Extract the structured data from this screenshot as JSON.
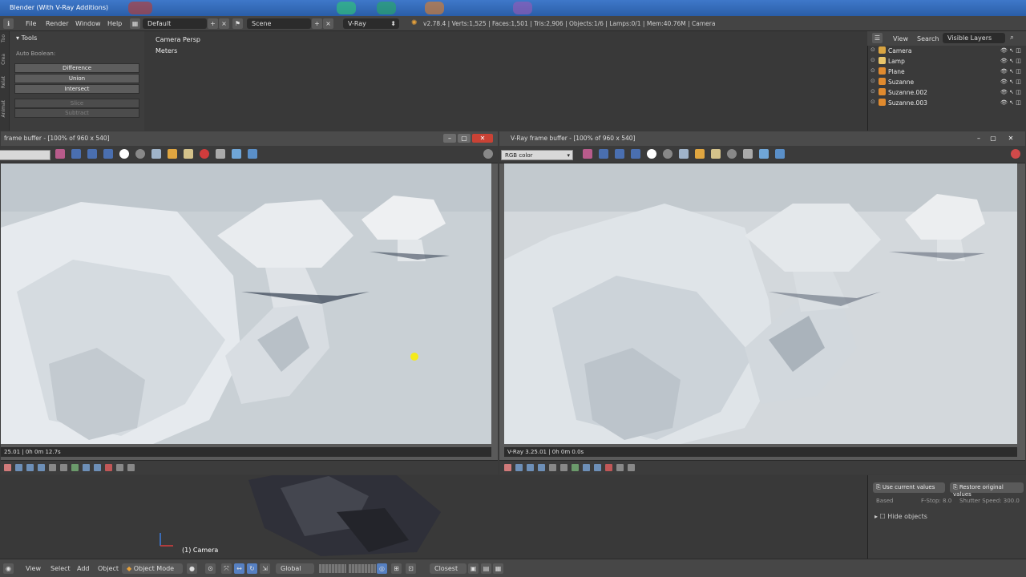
{
  "os": {
    "title": "Blender (With V-Ray Additions)"
  },
  "top_header": {
    "menus": [
      "File",
      "Render",
      "Window",
      "Help"
    ],
    "layout": "Default",
    "scene": "Scene",
    "engine": "V-Ray",
    "stats": "v2.78.4 | Verts:1,525 | Faces:1,501 | Tris:2,906 | Objects:1/6 | Lamps:0/1 | Mem:40.76M | Camera"
  },
  "toolshelf": {
    "panel_title": "Tools",
    "tabs": [
      "Too",
      "Crea",
      "Relat",
      "Animat"
    ],
    "auto_boolean": "Auto Boolean:",
    "buttons": [
      "Difference",
      "Union",
      "Intersect"
    ],
    "disabled_buttons": [
      "Slice",
      "Subtract"
    ]
  },
  "viewport": {
    "view_name": "Camera Persp",
    "units": "Meters",
    "object_label": "(1) Camera"
  },
  "outliner": {
    "menus": [
      "View",
      "Search"
    ],
    "filter": "Visible Layers",
    "items": [
      {
        "name": "Camera",
        "color": "#d9a441"
      },
      {
        "name": "Lamp",
        "color": "#e8c46a"
      },
      {
        "name": "Plane",
        "color": "#e08a2e"
      },
      {
        "name": "Suzanne",
        "color": "#e08a2e"
      },
      {
        "name": "Suzanne.002",
        "color": "#e08a2e"
      },
      {
        "name": "Suzanne.003",
        "color": "#e08a2e"
      }
    ]
  },
  "properties": {
    "use_current": "Use current values",
    "restore": "Restore original values",
    "based": "Based",
    "fstop": "F-Stop: 8.0",
    "shutter": "Shutter Speed: 300.0",
    "hide_objects": "Hide objects"
  },
  "vfb_left": {
    "title": "frame buffer - [100% of 960 x 540]",
    "status": "25.01 | 0h 0m 12.7s"
  },
  "vfb_right": {
    "title": "V-Ray frame buffer - [100% of 960 x 540]",
    "channel": "RGB color",
    "status": "V-Ray 3.25.01 | 0h 0m 0.0s"
  },
  "bottom_header": {
    "menus": [
      "View",
      "Select",
      "Add",
      "Object"
    ],
    "mode": "Object Mode",
    "orientation": "Global",
    "snap": "Closest"
  }
}
